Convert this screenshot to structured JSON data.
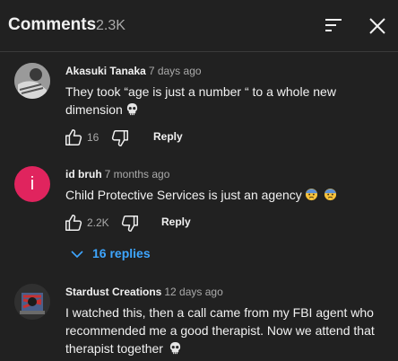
{
  "header": {
    "title": "Comments",
    "count": "2.3K",
    "sort_icon": "sort-icon",
    "close_icon": "close-icon"
  },
  "comments": [
    {
      "author": "Akasuki Tanaka",
      "time": "7 days ago",
      "text_line1": "They took “age is just a number “ to a whole new",
      "text_line2": "dimension",
      "emoji": "skull",
      "likes": "16",
      "reply": "Reply"
    },
    {
      "author": "id bruh",
      "time": "7 months ago",
      "avatar_letter": "i",
      "avatar_color": "#e0245e",
      "text_line1": "Child Protective Services is just an agency",
      "emoji": "anxious-face",
      "likes": "2.2K",
      "reply": "Reply",
      "replies_label": "16 replies"
    },
    {
      "author": "Stardust Creations",
      "time": "12 days ago",
      "text_line1": "I watched this, then a call came from my FBI agent who",
      "text_line2": "recommended me a good therapist. Now we attend that",
      "text_line3": "therapist together",
      "emoji": "skull"
    }
  ],
  "colors": {
    "background": "#212121",
    "link": "#3ea6ff",
    "muted": "#aaaaaa"
  }
}
